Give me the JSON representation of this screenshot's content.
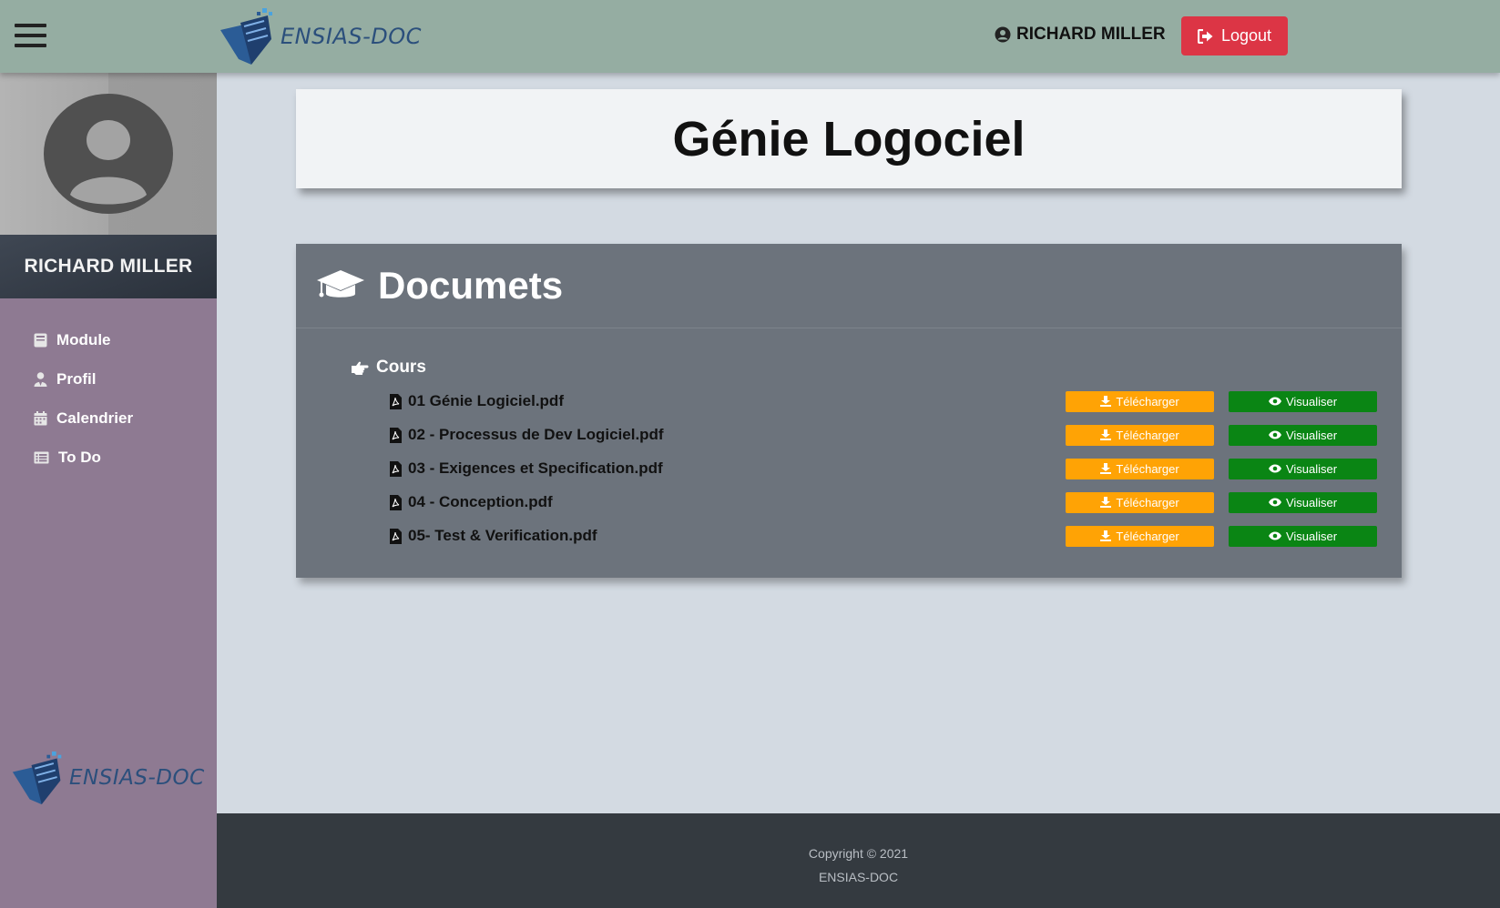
{
  "header": {
    "brand": "ENSIAS-DOC",
    "user_name": "RICHARD MILLER",
    "logout_label": "Logout"
  },
  "sidebar": {
    "user_name": "RICHARD MILLER",
    "items": [
      {
        "label": "Module",
        "icon": "book-icon"
      },
      {
        "label": "Profil",
        "icon": "user-tie-icon"
      },
      {
        "label": "Calendrier",
        "icon": "calendar-icon"
      },
      {
        "label": "To Do",
        "icon": "list-icon"
      }
    ],
    "brand": "ENSIAS-DOC"
  },
  "main": {
    "title": "Génie Logociel",
    "panel_title": "Documets",
    "section": "Cours",
    "download_label": "Télécharger",
    "view_label": "Visualiser",
    "files": [
      "01 Génie Logiciel.pdf",
      "02 - Processus de Dev Logiciel.pdf",
      "03 - Exigences et Specification.pdf",
      "04 - Conception.pdf",
      "05- Test & Verification.pdf"
    ]
  },
  "footer": {
    "copyright": "Copyright © 2021",
    "brand": "ENSIAS-DOC"
  },
  "colors": {
    "header": "#95ada2",
    "sidebar": "#8e7a92",
    "logout": "#dc3545",
    "download": "#ffa305",
    "view": "#0a8514",
    "panel": "#6c737c",
    "footer": "#343a40"
  }
}
